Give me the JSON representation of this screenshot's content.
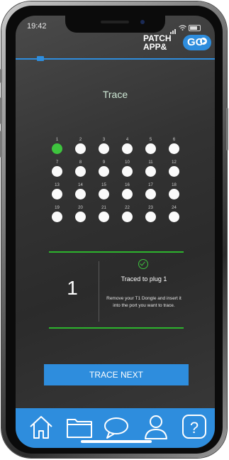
{
  "status": {
    "time": "19:42"
  },
  "brand": {
    "line1": "PATCH",
    "line2": "APP&",
    "badge": "GO"
  },
  "page": {
    "title": "Trace"
  },
  "ports": [
    {
      "label": "1",
      "active": true
    },
    {
      "label": "2",
      "active": false
    },
    {
      "label": "3",
      "active": false
    },
    {
      "label": "4",
      "active": false
    },
    {
      "label": "5",
      "active": false
    },
    {
      "label": "6",
      "active": false
    },
    {
      "label": "7",
      "active": false
    },
    {
      "label": "8",
      "active": false
    },
    {
      "label": "9",
      "active": false
    },
    {
      "label": "10",
      "active": false
    },
    {
      "label": "11",
      "active": false
    },
    {
      "label": "12",
      "active": false
    },
    {
      "label": "13",
      "active": false
    },
    {
      "label": "14",
      "active": false
    },
    {
      "label": "15",
      "active": false
    },
    {
      "label": "16",
      "active": false
    },
    {
      "label": "17",
      "active": false
    },
    {
      "label": "18",
      "active": false
    },
    {
      "label": "19",
      "active": false
    },
    {
      "label": "20",
      "active": false
    },
    {
      "label": "21",
      "active": false
    },
    {
      "label": "22",
      "active": false
    },
    {
      "label": "23",
      "active": false
    },
    {
      "label": "24",
      "active": false
    }
  ],
  "result": {
    "plug_number": "1",
    "status_text": "Traced to plug 1",
    "instructions": "Remove your T1 Dongle and insert it into the port you want to trace."
  },
  "actions": {
    "trace_next": "TRACE NEXT"
  },
  "tabbar": {
    "tabs": [
      {
        "icon": "home-icon"
      },
      {
        "icon": "folder-icon"
      },
      {
        "icon": "chat-bubble-icon"
      },
      {
        "icon": "user-icon"
      },
      {
        "icon": "help-icon"
      }
    ]
  },
  "colors": {
    "accent": "#2e8ddd",
    "active_port": "#3ec43e",
    "divider": "#2db42d"
  }
}
